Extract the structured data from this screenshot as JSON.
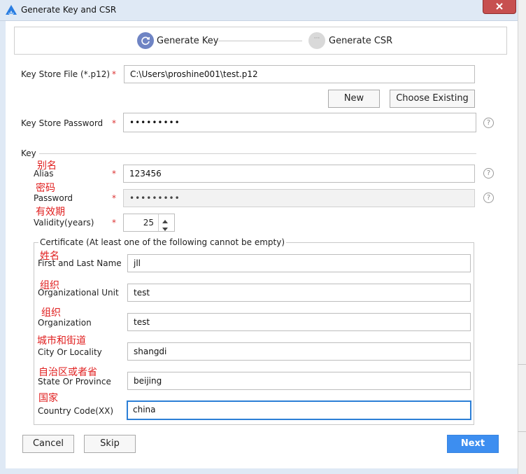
{
  "window": {
    "title": "Generate Key and CSR"
  },
  "steps": [
    {
      "label": "Generate Key",
      "state": "active"
    },
    {
      "label": "Generate CSR",
      "state": "pending",
      "marker": "···"
    }
  ],
  "keystore": {
    "file_label": "Key Store File (*.p12)",
    "file_value": "C:\\Users\\proshine001\\test.p12",
    "new_button": "New",
    "choose_button": "Choose Existing",
    "password_label": "Key Store Password",
    "password_value": "•••••••••"
  },
  "key": {
    "section_label": "Key",
    "alias_label": "Alias",
    "alias_value": "123456",
    "password_label": "Password",
    "password_value": "•••••••••",
    "validity_label": "Validity(years)",
    "validity_value": "25"
  },
  "certificate": {
    "legend": "Certificate (At least one of the following cannot be empty)",
    "fields": [
      {
        "label": "First and Last Name",
        "value": "jll"
      },
      {
        "label": "Organizational Unit",
        "value": "test"
      },
      {
        "label": "Organization",
        "value": "test"
      },
      {
        "label": "City Or Locality",
        "value": "shangdi"
      },
      {
        "label": "State Or Province",
        "value": "beijing"
      },
      {
        "label": "Country Code(XX)",
        "value": "china"
      }
    ]
  },
  "annotations": {
    "alias": "别名",
    "password": "密码",
    "validity": "有效期",
    "name": "姓名",
    "org_unit": "组织",
    "org": "组织",
    "city": "城市和街道",
    "state": "自治区或者省",
    "country": "国家"
  },
  "common": {
    "required_mark": "*",
    "help_glyph": "?"
  },
  "footer": {
    "cancel": "Cancel",
    "skip": "Skip",
    "next": "Next"
  },
  "colors": {
    "accent": "#3d8ef0",
    "step_active": "#6f84c4",
    "required": "#dd3333",
    "annotation": "#e01e1e",
    "titlebar": "#dfe9f5",
    "close": "#c75050"
  },
  "icons": {
    "app": "app-logo-icon",
    "close": "close-icon",
    "step_active": "refresh-icon",
    "help": "help-icon",
    "spin_up": "chevron-up-icon",
    "spin_down": "chevron-down-icon"
  }
}
